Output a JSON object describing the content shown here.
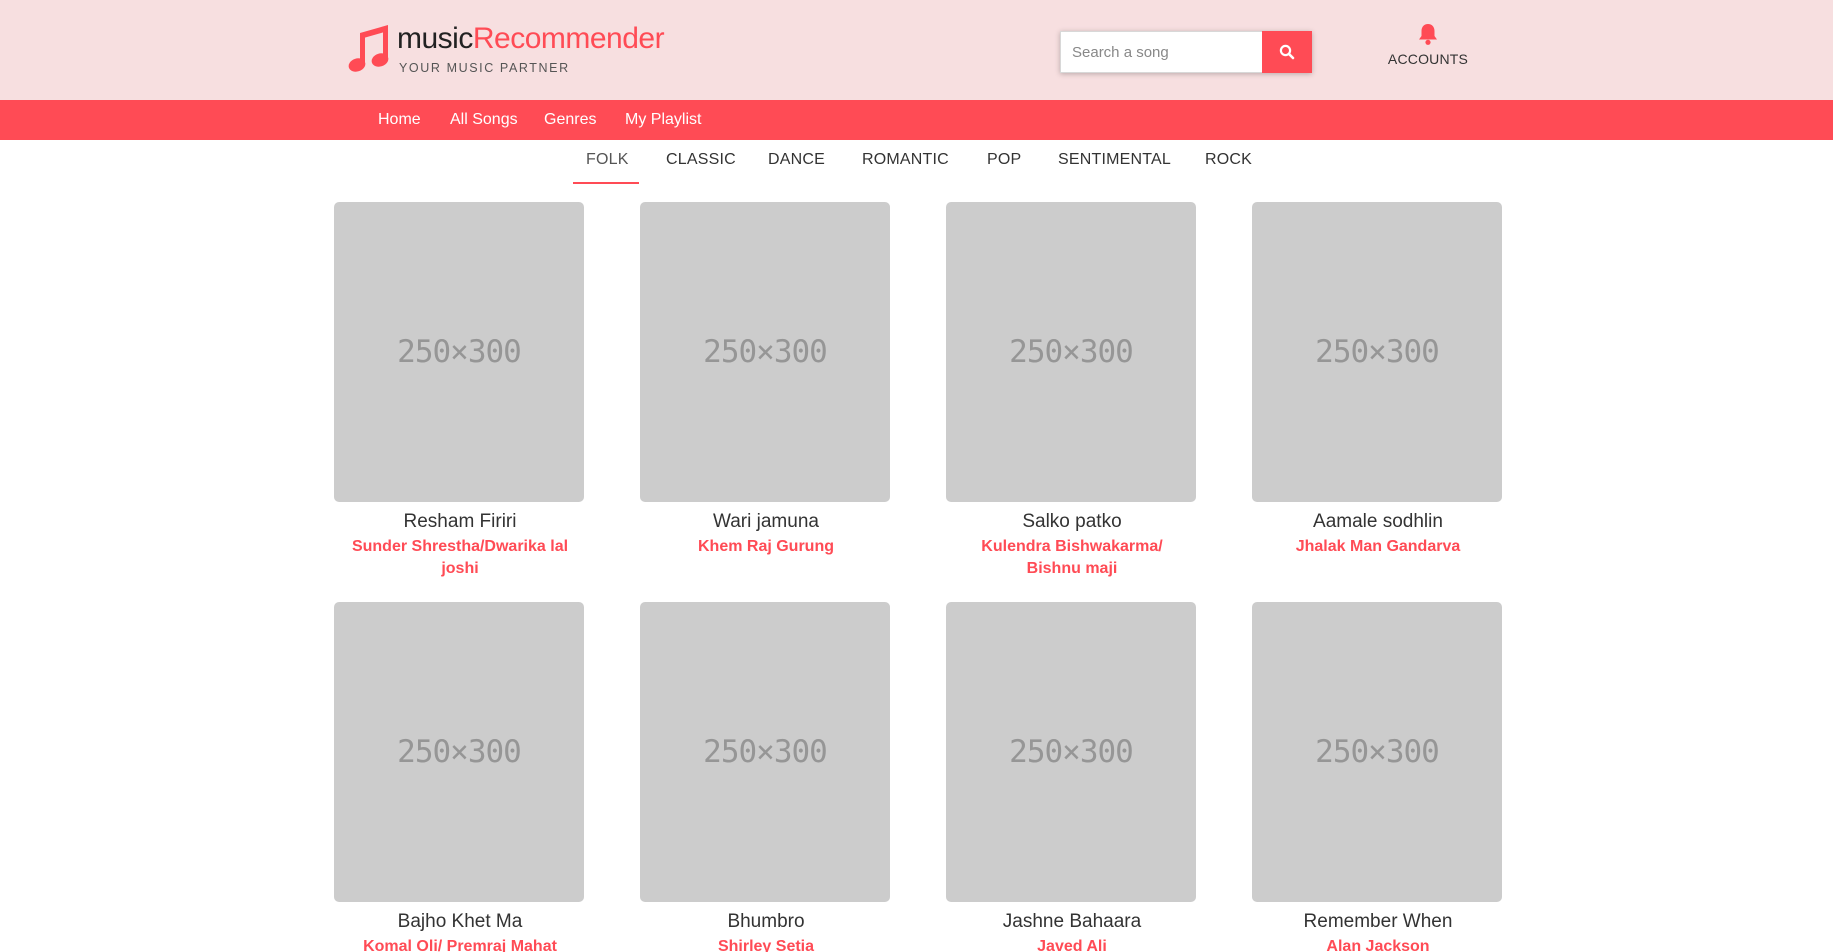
{
  "brand": {
    "name_part1": "music",
    "name_part2": "Recommender",
    "tagline": "YOUR MUSIC PARTNER",
    "accent_color": "#ff4b55",
    "header_bg": "#f7dfe0"
  },
  "search": {
    "placeholder": "Search a song",
    "value": "",
    "button_icon": "search-icon"
  },
  "account": {
    "label": "ACCOUNTS",
    "icon": "bell-icon"
  },
  "nav": {
    "items": [
      {
        "label": "Home"
      },
      {
        "label": "All Songs"
      },
      {
        "label": "Genres"
      },
      {
        "label": "My Playlist"
      }
    ]
  },
  "genres": {
    "active": "FOLK",
    "tabs": [
      {
        "label": "FOLK"
      },
      {
        "label": "CLASSIC"
      },
      {
        "label": "DANCE"
      },
      {
        "label": "ROMANTIC"
      },
      {
        "label": "POP"
      },
      {
        "label": "SENTIMENTAL"
      },
      {
        "label": "ROCK"
      }
    ]
  },
  "songs": [
    {
      "image_label": "250×300",
      "title": "Resham Firiri",
      "artist": "Sunder Shrestha/Dwarika lal joshi"
    },
    {
      "image_label": "250×300",
      "title": "Wari jamuna",
      "artist": "Khem Raj Gurung"
    },
    {
      "image_label": "250×300",
      "title": "Salko patko",
      "artist": "Kulendra Bishwakarma/ Bishnu maji"
    },
    {
      "image_label": "250×300",
      "title": "Aamale sodhlin",
      "artist": "Jhalak Man Gandarva"
    },
    {
      "image_label": "250×300",
      "title": "Bajho Khet Ma",
      "artist": "Komal Oli/ Premraj Mahat"
    },
    {
      "image_label": "250×300",
      "title": "Bhumbro",
      "artist": "Shirley Setia"
    },
    {
      "image_label": "250×300",
      "title": "Jashne Bahaara",
      "artist": "Javed Ali"
    },
    {
      "image_label": "250×300",
      "title": "Remember When",
      "artist": "Alan Jackson"
    }
  ]
}
